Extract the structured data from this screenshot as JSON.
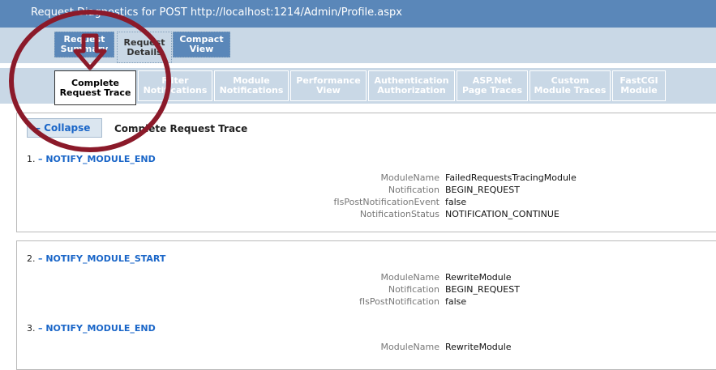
{
  "window": {
    "title": "Request Diagnostics for POST http://localhost:1214/Admin/Profile.aspx"
  },
  "main_tabs": [
    {
      "label_line1": "Request",
      "label_line2": "Summary"
    },
    {
      "label_line1": "Request",
      "label_line2": "Details"
    },
    {
      "label_line1": "Compact",
      "label_line2": "View"
    }
  ],
  "sub_tabs": [
    {
      "label_line1": "Complete",
      "label_line2": "Request Trace"
    },
    {
      "label_line1": "Filter",
      "label_line2": "Notifications"
    },
    {
      "label_line1": "Module",
      "label_line2": "Notifications"
    },
    {
      "label_line1": "Performance",
      "label_line2": "View"
    },
    {
      "label_line1": "Authentication",
      "label_line2": "Authorization"
    },
    {
      "label_line1": "ASP.Net",
      "label_line2": "Page Traces"
    },
    {
      "label_line1": "Custom",
      "label_line2": "Module Traces"
    },
    {
      "label_line1": "FastCGI",
      "label_line2": "Module"
    }
  ],
  "panel": {
    "collapse_label": "– Collapse",
    "title": "Complete Request Trace"
  },
  "events": [
    {
      "number": "1.",
      "name": "– NOTIFY_MODULE_END",
      "props": [
        {
          "k": "ModuleName",
          "v": "FailedRequestsTracingModule"
        },
        {
          "k": "Notification",
          "v": "BEGIN_REQUEST"
        },
        {
          "k": "fIsPostNotificationEvent",
          "v": "false"
        },
        {
          "k": "NotificationStatus",
          "v": "NOTIFICATION_CONTINUE"
        }
      ]
    },
    {
      "number": "2.",
      "name": "– NOTIFY_MODULE_START",
      "props": [
        {
          "k": "ModuleName",
          "v": "RewriteModule"
        },
        {
          "k": "Notification",
          "v": "BEGIN_REQUEST"
        },
        {
          "k": "fIsPostNotification",
          "v": "false"
        }
      ]
    },
    {
      "number": "3.",
      "name": "– NOTIFY_MODULE_END",
      "props": [
        {
          "k": "ModuleName",
          "v": "RewriteModule"
        }
      ]
    }
  ],
  "colors": {
    "titlebar": "#5a87b9",
    "tabband": "#c9d8e6",
    "link": "#1a66c8",
    "annotation": "#8b1a2a"
  }
}
